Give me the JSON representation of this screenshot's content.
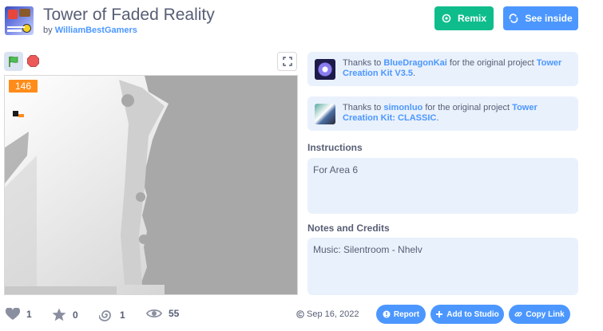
{
  "project": {
    "title": "Tower of Faded Reality",
    "by_prefix": "by",
    "author": "WilliamBestGamers"
  },
  "header": {
    "remix_label": "Remix",
    "see_inside_label": "See inside"
  },
  "stage": {
    "counter_value": "146"
  },
  "credits": [
    {
      "prefix": "Thanks to",
      "user": "BlueDragonKai",
      "middle": "for the original project",
      "project": "Tower Creation Kit V3.5",
      "suffix": "."
    },
    {
      "prefix": "Thanks to",
      "user": "simonluo",
      "middle": "for the original project",
      "project": "Tower Creation Kit: CLASSIC",
      "suffix": "."
    }
  ],
  "instructions": {
    "heading": "Instructions",
    "text": "For Area 6"
  },
  "notes": {
    "heading": "Notes and Credits",
    "text": "Music: Silentroom - Nhelv"
  },
  "stats": {
    "loves": "1",
    "favorites": "0",
    "remixes": "1",
    "views": "55"
  },
  "footer": {
    "date": "Sep 16, 2022",
    "report_label": "Report",
    "add_to_studio_label": "Add to Studio",
    "copy_link_label": "Copy Link"
  },
  "colors": {
    "remix": "#0fbd8c",
    "primary": "#4c97ff",
    "counter": "#ff8c1a",
    "panel": "#e9f1fc"
  }
}
